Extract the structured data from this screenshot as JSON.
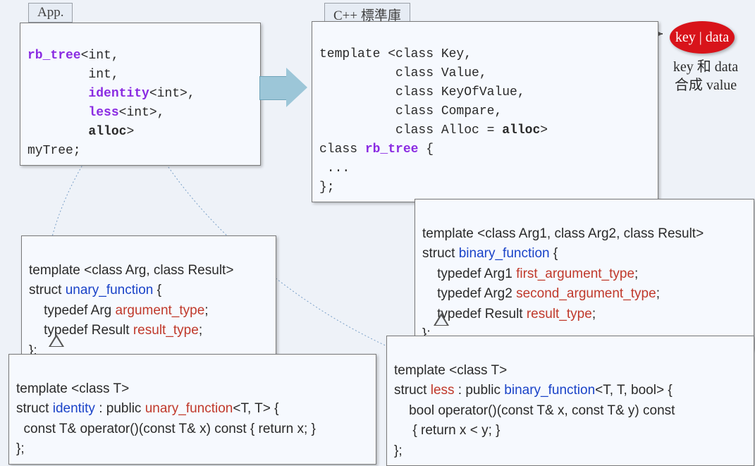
{
  "labels": {
    "app": "App.",
    "stdlib": "C++ 標準庫"
  },
  "app_code": {
    "l1a": "rb_tree",
    "l1b": "<int,",
    "l2": "        int,",
    "l3a": "        ",
    "l3b": "identity",
    "l3c": "<int>,",
    "l4a": "        ",
    "l4b": "less",
    "l4c": "<int>,",
    "l5a": "        ",
    "l5b": "alloc",
    "l5c": ">",
    "l6": "myTree;"
  },
  "stdlib_code": {
    "l1": "template <class Key,",
    "l2": "          class Value,",
    "l3": "          class KeyOfValue,",
    "l4": "          class Compare,",
    "l5a": "          class Alloc = ",
    "l5b": "alloc",
    "l5c": ">",
    "l6a": "class ",
    "l6b": "rb_tree",
    "l6c": " {",
    "l7": " ...",
    "l8": "};"
  },
  "unary": {
    "l1": "template <class Arg, class Result>",
    "l2a": "struct ",
    "l2b": "unary_function",
    "l2c": " {",
    "l3a": "    typedef Arg ",
    "l3b": "argument_type",
    "l3c": ";",
    "l4a": "    typedef Result ",
    "l4b": "result_type",
    "l4c": ";",
    "l5": "};"
  },
  "identity": {
    "l1": "template <class T>",
    "l2a": "struct ",
    "l2b": "identity",
    "l2c": " : public ",
    "l2d": "unary_function",
    "l2e": "<T, T> {",
    "l3": "  const T& operator()(const T& x) const { return x; }",
    "l4": "};"
  },
  "binary": {
    "l1": "template <class Arg1, class Arg2, class Result>",
    "l2a": "struct ",
    "l2b": "binary_function",
    "l2c": " {",
    "l3a": "    typedef Arg1 ",
    "l3b": "first_argument_type",
    "l3c": ";",
    "l4a": "    typedef Arg2 ",
    "l4b": "second_argument_type",
    "l4c": ";",
    "l5a": "    typedef Result ",
    "l5b": "result_type",
    "l5c": ";",
    "l6": "};"
  },
  "less": {
    "l1": "template <class T>",
    "l2a": "struct ",
    "l2b": "less",
    "l2c": " : public ",
    "l2d": "binary_function",
    "l2e": "<T, T, bool> {",
    "l3": "    bool operator()(const T& x, const T& y) const",
    "l4": "     { return x < y; }",
    "l5": "};"
  },
  "ellipse": "key | data",
  "note": {
    "l1": "key 和 data",
    "l2": "合成 value"
  }
}
